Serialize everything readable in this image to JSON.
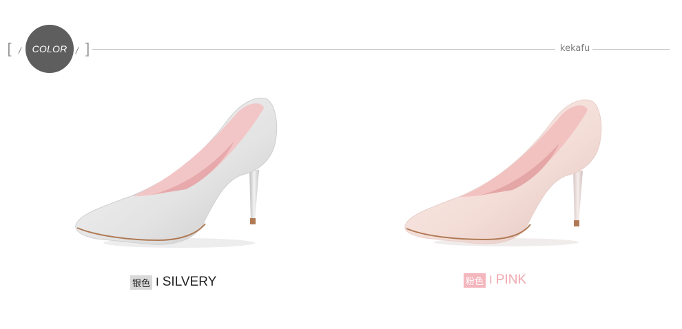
{
  "header": {
    "badge_label": "COLOR",
    "brand": "kekafu",
    "bracket_left": "[",
    "bracket_right": "]",
    "slash": "/"
  },
  "products": [
    {
      "tag": "银色",
      "separator": "I",
      "name": "SILVERY",
      "icon": "silver-high-heel-shoe-icon"
    },
    {
      "tag": "粉色",
      "separator": "I",
      "name": "PINK",
      "icon": "pink-high-heel-shoe-icon"
    }
  ],
  "colors": {
    "badge": "#5e5e5e",
    "rule": "#b5b5b5",
    "silver_tag_bg": "#d9d9d9",
    "pink_tag_bg": "#f4b6bd",
    "pink_text": "#f0a7ae"
  }
}
